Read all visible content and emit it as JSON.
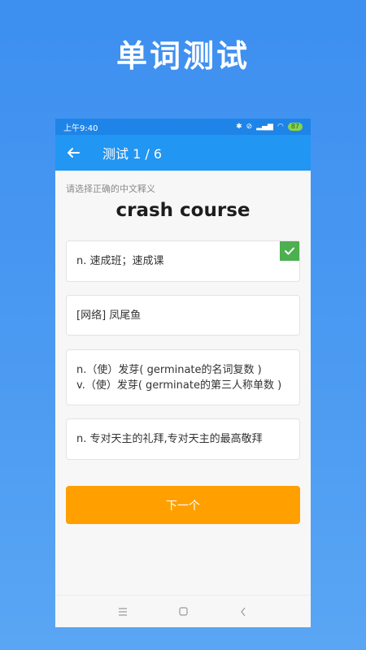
{
  "headline": "单词测试",
  "status_bar": {
    "time": "上午9:40",
    "battery": "87"
  },
  "app_bar": {
    "title": "测试 1 / 6",
    "back_icon": "arrow-left-icon"
  },
  "quiz": {
    "instruction": "请选择正确的中文释义",
    "word": "crash course",
    "options": [
      {
        "lines": [
          "n. 速成班；速成课"
        ],
        "correct": true
      },
      {
        "lines": [
          "[网络] 凤尾鱼"
        ]
      },
      {
        "lines": [
          "n.（使）发芽( germinate的名词复数 )",
          "v.（使）发芽( germinate的第三人称单数 )"
        ]
      },
      {
        "lines": [
          "n. 专对天主的礼拜,专对天主的最高敬拜"
        ]
      }
    ],
    "next_label": "下一个"
  },
  "colors": {
    "app_bar": "#2196f3",
    "correct_badge": "#4caf50",
    "next_button": "#ffa000"
  }
}
